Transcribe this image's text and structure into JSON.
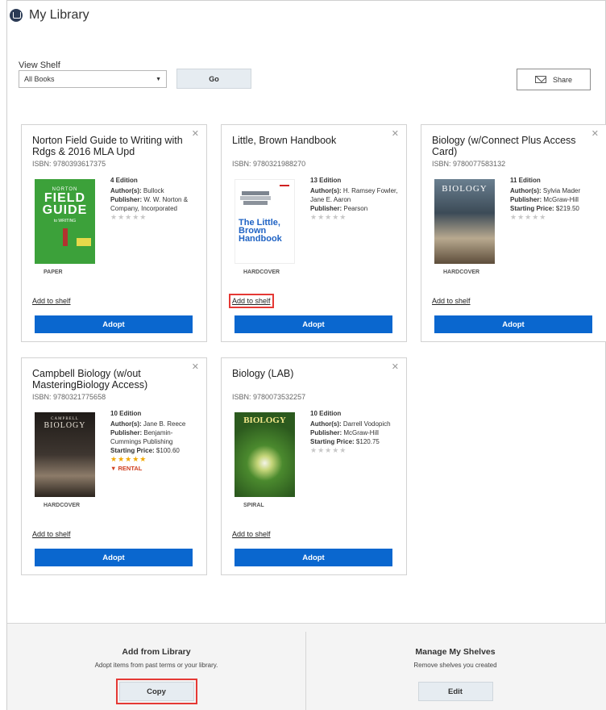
{
  "page": {
    "title": "My Library"
  },
  "shelf": {
    "label": "View Shelf",
    "selected": "All Books",
    "go_label": "Go",
    "share_label": "Share"
  },
  "cards": [
    {
      "title": "Norton Field Guide to Writing with Rdgs & 2016 MLA Upd",
      "isbn": "ISBN: 9780393617375",
      "edition": "4 Edition",
      "authors_label": "Author(s):",
      "authors": "Bullock",
      "publisher_label": "Publisher:",
      "publisher": "W. W. Norton & Company, Incorporated",
      "stars": "★★★★★",
      "format": "PAPER",
      "add_to_shelf": "Add to shelf",
      "adopt": "Adopt",
      "cover_text": {
        "top": "NORTON",
        "main": "FIELD GUIDE",
        "sub": "to WRITING"
      }
    },
    {
      "title": "Little, Brown Handbook",
      "isbn": "ISBN: 9780321988270",
      "edition": "13 Edition",
      "authors_label": "Author(s):",
      "authors": "H. Ramsey Fowler, Jane E. Aaron",
      "publisher_label": "Publisher:",
      "publisher": "Pearson",
      "stars": "★★★★★",
      "format": "HARDCOVER",
      "add_to_shelf": "Add to shelf",
      "adopt": "Adopt",
      "cover_text": {
        "main": "The Little, Brown Handbook"
      }
    },
    {
      "title": "Biology (w/Connect Plus Access Card)",
      "isbn": "ISBN: 9780077583132",
      "edition": "11 Edition",
      "authors_label": "Author(s):",
      "authors": "Sylvia Mader",
      "publisher_label": "Publisher:",
      "publisher": "McGraw-Hill",
      "price_label": "Starting Price:",
      "price": "$219.50",
      "stars": "★★★★★",
      "format": "HARDCOVER",
      "add_to_shelf": "Add to shelf",
      "adopt": "Adopt",
      "cover_text": {
        "main": "BIOLOGY"
      }
    },
    {
      "title": "Campbell Biology (w/out MasteringBiology Access)",
      "isbn": "ISBN: 9780321775658",
      "edition": "10 Edition",
      "authors_label": "Author(s):",
      "authors": "Jane B. Reece",
      "publisher_label": "Publisher:",
      "publisher": "Benjamin-Cummings Publishing",
      "price_label": "Starting Price:",
      "price": "$100.60",
      "stars": "★★★★★",
      "rental": "RENTAL",
      "format": "HARDCOVER",
      "add_to_shelf": "Add to shelf",
      "adopt": "Adopt",
      "cover_text": {
        "top": "CAMPBELL",
        "main": "BIOLOGY"
      }
    },
    {
      "title": "Biology (LAB)",
      "isbn": "ISBN: 9780073532257",
      "edition": "10 Edition",
      "authors_label": "Author(s):",
      "authors": "Darrell Vodopich",
      "publisher_label": "Publisher:",
      "publisher": "McGraw-Hill",
      "price_label": "Starting Price:",
      "price": "$120.75",
      "stars": "★★★★★",
      "format": "SPIRAL",
      "add_to_shelf": "Add to shelf",
      "adopt": "Adopt",
      "cover_text": {
        "main": "BIOLOGY"
      }
    }
  ],
  "footer": {
    "left": {
      "title": "Add from Library",
      "subtitle": "Adopt items from past terms or your library.",
      "button": "Copy"
    },
    "right": {
      "title": "Manage My Shelves",
      "subtitle": "Remove shelves you created",
      "button": "Edit"
    }
  },
  "icons": {
    "title": "library-book-icon",
    "share": "mail-icon",
    "close": "close-icon",
    "select": "chevron-down-icon"
  },
  "colors": {
    "adopt_button": "#0a67cf",
    "highlight": "#e53935",
    "star_gold": "#f2a800",
    "rental": "#d04020"
  }
}
